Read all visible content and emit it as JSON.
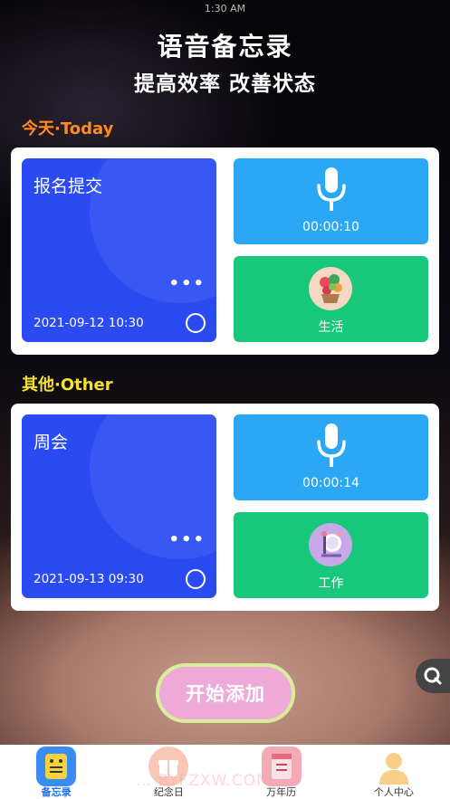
{
  "status_bar": {
    "time": "1:30 AM"
  },
  "header": {
    "title": "语音备忘录",
    "subtitle": "提高效率 改善状态"
  },
  "sections": [
    {
      "label": "今天·Today",
      "memo": {
        "title": "报名提交",
        "dots": "•••",
        "datetime": "2021-09-12 10:30"
      },
      "audio_duration": "00:00:10",
      "category": "生活"
    },
    {
      "label": "其他·Other",
      "memo": {
        "title": "周会",
        "dots": "•••",
        "datetime": "2021-09-13 09:30"
      },
      "audio_duration": "00:00:14",
      "category": "工作"
    }
  ],
  "add_button": "开始添加",
  "tabbar": {
    "items": [
      {
        "label": "备忘录",
        "icon": "memo-icon",
        "active": true
      },
      {
        "label": "纪念日",
        "icon": "gift-icon",
        "active": false
      },
      {
        "label": "万年历",
        "icon": "calendar-icon",
        "active": false
      },
      {
        "label": "个人中心",
        "icon": "profile-icon",
        "active": false
      }
    ]
  },
  "watermark": "… BYFZXW.COM",
  "colors": {
    "today_label": "#ff8a1e",
    "other_label": "#f5e22a",
    "memo_blue": "#2a4bf2",
    "audio_blue": "#2aa8f5",
    "category_green": "#17c87a",
    "add_button_pink": "#eea9d8"
  }
}
